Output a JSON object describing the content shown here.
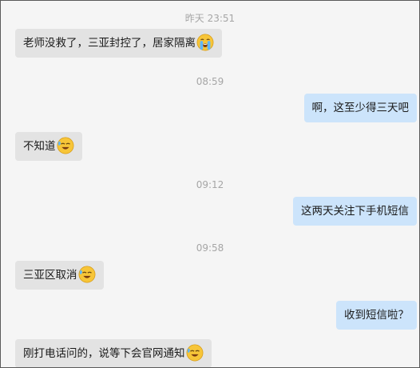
{
  "messages": [
    {
      "kind": "time",
      "text": "昨天 23:51"
    },
    {
      "kind": "in",
      "text": "老师没救了，三亚封控了，居家隔离",
      "emoji": "loudly-crying-face-icon"
    },
    {
      "kind": "time",
      "text": "08:59"
    },
    {
      "kind": "out",
      "text": "啊，这至少得三天吧"
    },
    {
      "kind": "in",
      "text": "不知道",
      "emoji": "sweating-face-icon"
    },
    {
      "kind": "time",
      "text": "09:12"
    },
    {
      "kind": "out",
      "text": "这两天关注下手机短信"
    },
    {
      "kind": "time",
      "text": "09:58"
    },
    {
      "kind": "in",
      "text": "三亚区取消",
      "emoji": "sweating-face-icon"
    },
    {
      "kind": "out",
      "text": "收到短信啦？"
    },
    {
      "kind": "in",
      "text": "刚打电话问的，说等下会官网通知",
      "emoji": "sweating-face-icon"
    }
  ],
  "colors": {
    "incoming_bubble": "#e3e3e3",
    "outgoing_bubble": "#cce4fb",
    "timestamp": "#a6a6a6",
    "background": "#f5f5f5"
  }
}
